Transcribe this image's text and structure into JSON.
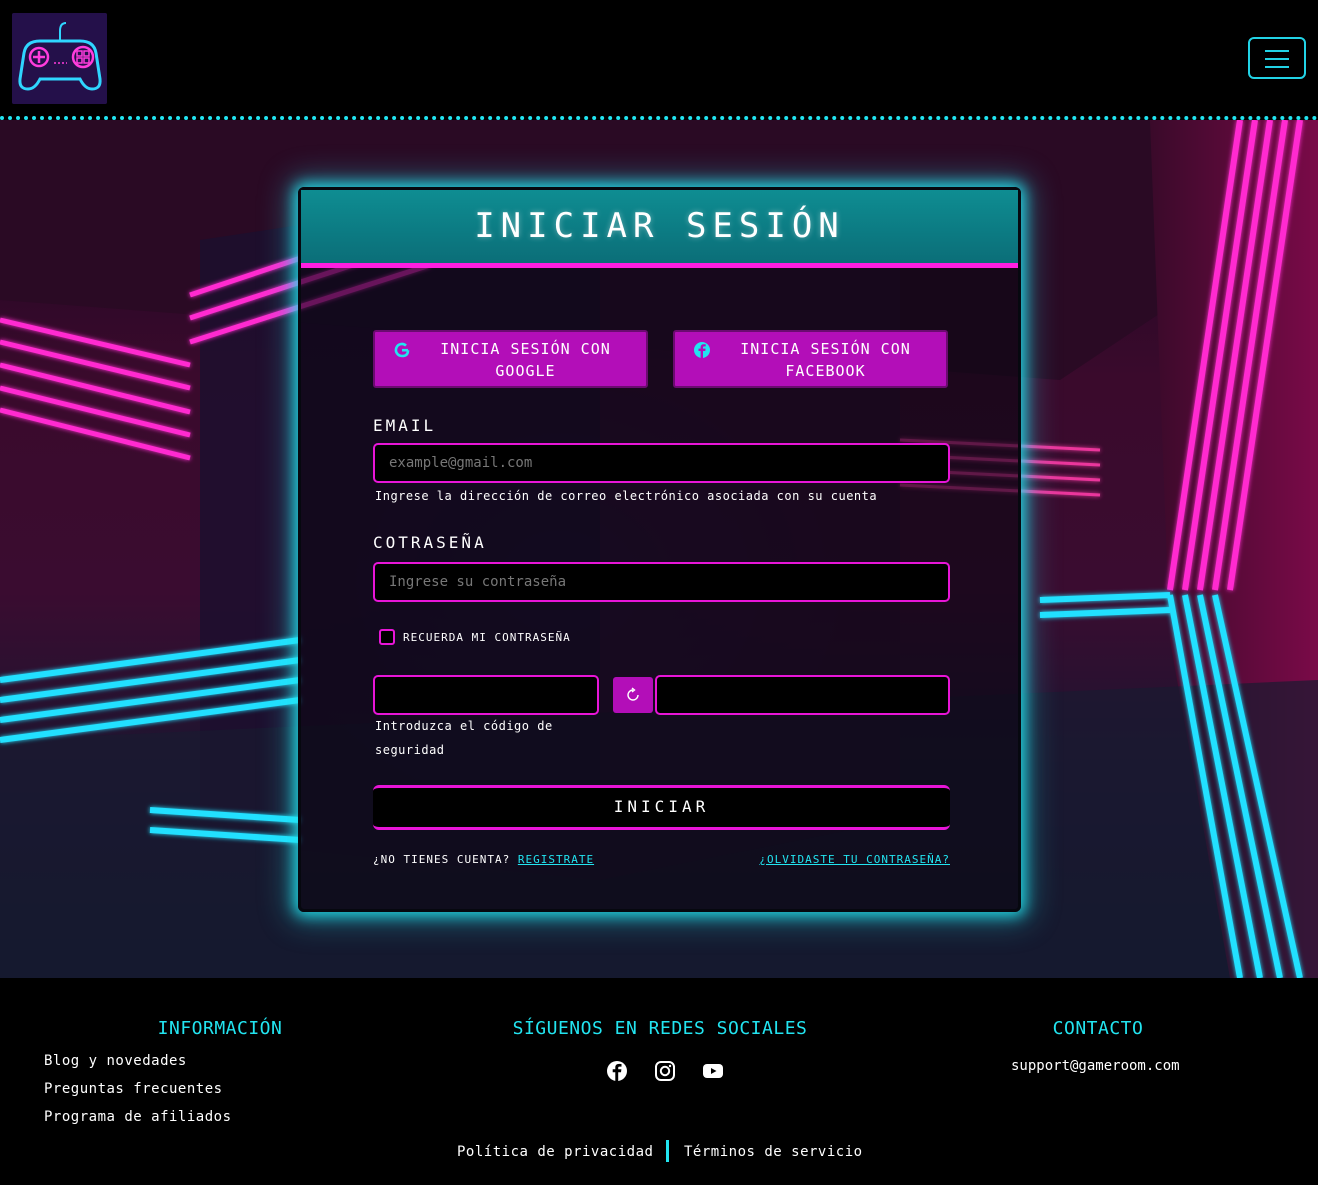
{
  "header": {
    "logo_alt": "gamepad-logo",
    "menu_icon": "hamburger-icon"
  },
  "login": {
    "title": "INICIAR SESIÓN",
    "google_button": "INICIA SESIÓN CON GOOGLE",
    "facebook_button": "INICIA SESIÓN CON FACEBOOK",
    "email_label": "EMAIL",
    "email_placeholder": "example@gmail.com",
    "email_help": "Ingrese la dirección de correo electrónico asociada con su cuenta",
    "password_label": "COTRASEÑA",
    "password_placeholder": "Ingrese su contraseña",
    "remember_label": "RECUERDA MI CONTRASEÑA",
    "captcha_help": "Introduzca el código de seguridad",
    "captcha_help_line1": "Introduzca el código de",
    "captcha_help_line2": "seguridad",
    "submit_label": "INICIAR",
    "no_account_text": "¿NO TIENES CUENTA?",
    "register_link": "REGISTRATE",
    "forgot_link": "¿OLVIDASTE TU CONTRASEÑA?"
  },
  "footer": {
    "info_title": "INFORMACIÓN",
    "info_links": [
      "Blog y novedades",
      "Preguntas frecuentes",
      "Programa de afiliados"
    ],
    "social_title": "SÍGUENOS EN REDES SOCIALES",
    "social_icons": [
      "facebook-icon",
      "instagram-icon",
      "youtube-icon"
    ],
    "contact_title": "CONTACTO",
    "contact_email": "support@gameroom.com",
    "privacy_link": "Política de privacidad",
    "terms_link": "Términos de servicio"
  },
  "colors": {
    "accent_cyan": "#22e4f0",
    "accent_magenta": "#e815d8",
    "button_purple": "#b30eb8"
  }
}
